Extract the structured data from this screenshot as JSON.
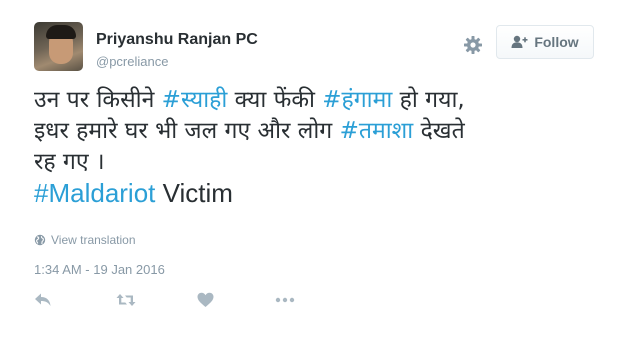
{
  "user": {
    "name": "Priyanshu Ranjan PC",
    "handle": "@pcreliance"
  },
  "header": {
    "settings_icon": "gear-icon",
    "follow_label": "Follow",
    "follow_icon": "add-user-icon"
  },
  "tweet": {
    "line1": {
      "t1": "उन पर किसीने ",
      "h1": "#स्याही",
      "t2": " क्या फेंकी ",
      "h2": "#हंगामा",
      "t3": " हो गया,"
    },
    "line2": {
      "t1": "इधर हमारे घर भी जल गए और लोग ",
      "h1": "#तमाशा",
      "t2": " देखते"
    },
    "line3": {
      "t1": "रह गए ।"
    },
    "line4": {
      "h1": "#Maldariot",
      "t1": " Victim"
    }
  },
  "translation": {
    "label": "View translation",
    "icon": "globe-icon"
  },
  "timestamp": "1:34 AM - 19 Jan 2016",
  "actions": {
    "reply_icon": "reply-icon",
    "retweet_icon": "retweet-icon",
    "like_icon": "heart-icon",
    "more_icon": "more-icon"
  },
  "colors": {
    "hashtag": "#2b9fd6",
    "text": "#292f33",
    "muted": "#8899a6",
    "icon": "#aab8c2"
  }
}
